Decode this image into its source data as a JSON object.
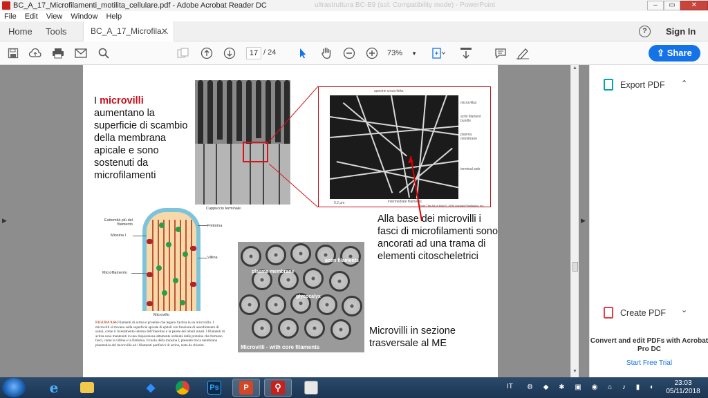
{
  "window": {
    "title": "BC_A_17_Microfilamenti_motilita_cellulare.pdf - Adobe Acrobat Reader DC",
    "background_title": "ultrastruttura BC-B9 (sol: Compatibility mode) - PowerPoint",
    "minimize_label": "–",
    "maximize_label": "▭",
    "close_label": "✕"
  },
  "menu": [
    "File",
    "Edit",
    "View",
    "Window",
    "Help"
  ],
  "tabs": {
    "home": "Home",
    "tools": "Tools",
    "document": "BC_A_17_Microfila...",
    "close": "✕",
    "help": "?",
    "sign_in": "Sign In"
  },
  "toolbar": {
    "current_page": "17",
    "total_pages": "/ 24",
    "zoom": "73%",
    "share_label": "Share",
    "icons": [
      "save-icon",
      "upload-icon",
      "print-icon",
      "email-icon",
      "search-icon",
      "page-thumbnails-icon",
      "prev-page-icon",
      "next-page-icon",
      "select-arrow-icon",
      "hand-tool-icon",
      "zoom-out-icon",
      "zoom-in-icon",
      "fit-page-icon",
      "scroll-mode-icon",
      "comment-icon",
      "sign-icon"
    ]
  },
  "slide": {
    "intro_part1": "I ",
    "intro_highlight": "microvilli",
    "intro_rest": " aumentano la superficie di scambio della membrana apicale e sono sostenuti da microfilamenti",
    "caption_base": "Alla base dei microvilli i fasci di microfilamenti sono ancorati ad una trama di elementi citoscheletrici",
    "caption_section": "Microvilli in sezione trasversale al ME",
    "inset_labels": {
      "top": "spectrin cross-links",
      "microvillus": "microvillus",
      "actin": "actin filament bundle",
      "plasma": "plasma membrane",
      "terminal": "terminal web",
      "bottom": "intermediate filaments",
      "scale": "0.2 μm",
      "credit": "From The Art of Kidd © 1995 Garland Publishing, Inc."
    },
    "diagram_labels": {
      "cap": "Cappuccio terminale",
      "tip": "Estremità più del filamento",
      "fimbrin": "Fimbrina",
      "myosin": "Miosina I",
      "villin": "Villina",
      "microfilament": "Microfilamento",
      "title": "Microvillo"
    },
    "figure_tag": "FIGURA 9.66",
    "figure_caption": " Filamenti di actina e proteine che legano l'actina in un microvillo. I microvilli si trovano sulla superficie apicale di epiteli con funzione di assorbimento di soluti, come il rivestimento interno dell'intestino e la parete dei tubuli renali. I filamenti di actina sono mantenuti in una disposizione altamente ordinata dalle proteine che formano fasci, come la villina e la fimbrina. Il ruolo della miosina I, presente tra la membrana plasmatica del microvillo ed i filamenti periferici di actina, resta da chiarire.",
    "xsec_labels": {
      "actin": "actin filaments",
      "plasma": "plasma membrane",
      "glyco": "glycocalyx",
      "bottom": "Microvilli - with core filaments"
    }
  },
  "right_panel": {
    "export_pdf": "Export PDF",
    "create_pdf": "Create PDF",
    "chevron_up": "⌃",
    "chevron_down": "⌄",
    "promo": "Convert and edit PDFs with Acrobat Pro DC",
    "trial": "Start Free Trial"
  },
  "taskbar": {
    "apps": [
      "internet-explorer",
      "file-explorer",
      "dropbox",
      "chrome",
      "photoshop",
      "powerpoint",
      "acrobat",
      "notepad"
    ],
    "ps_label": "Ps",
    "ppt_label": "P",
    "lang": "IT",
    "time": "23:03",
    "date": "05/11/2018"
  }
}
